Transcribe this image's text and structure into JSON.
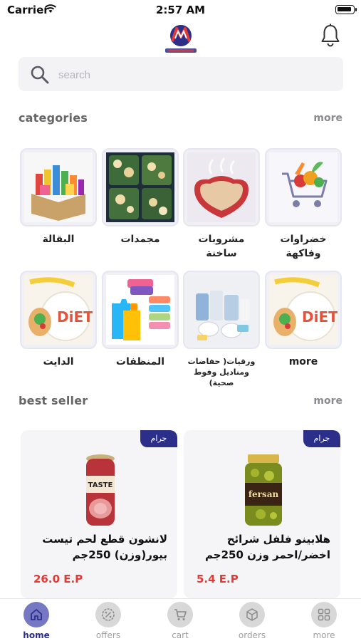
{
  "status_bar": {
    "carrier": "Carrier",
    "time": "2:57 AM"
  },
  "header": {
    "logo_icon": "store-logo-icon",
    "notification_icon": "bell-icon"
  },
  "search": {
    "placeholder": "search",
    "value": ""
  },
  "categories_section": {
    "title": "categories",
    "more_label": "more",
    "items": [
      {
        "label": "خضراوات وفاكهة",
        "icon": "vegetables-cart-image"
      },
      {
        "label": "مشروبات ساخنة",
        "icon": "hot-drinks-image"
      },
      {
        "label": "مجمدات",
        "icon": "frozen-food-image"
      },
      {
        "label": "البقالة",
        "icon": "grocery-box-image"
      },
      {
        "label": "more",
        "icon": "diet-plate-image"
      },
      {
        "label": "ورقيات( حفاضات ومناديل وفوط صحية)",
        "icon": "paper-products-image"
      },
      {
        "label": "المنظفات",
        "icon": "detergents-image"
      },
      {
        "label": "الدايت",
        "icon": "diet-plate-image"
      }
    ]
  },
  "best_seller_section": {
    "title": "best seller",
    "more_label": "more",
    "products": [
      {
        "badge": "جرام",
        "name": "هلابينو فلفل شرائح اخضر/احمر وزن 250جم",
        "price": "5.4 E.P",
        "image": "pickled-jar-image"
      },
      {
        "badge": "جرام",
        "name": "لانشون قطع لحم تيست بيور(وزن) 250جم",
        "price": "26.0 E.P",
        "image": "luncheon-meat-image"
      }
    ]
  },
  "tab_bar": {
    "items": [
      {
        "label": "home",
        "icon": "home-icon",
        "active": true
      },
      {
        "label": "offers",
        "icon": "offers-percent-icon",
        "active": false
      },
      {
        "label": "cart",
        "icon": "cart-icon",
        "active": false
      },
      {
        "label": "orders",
        "icon": "box-icon",
        "active": false
      },
      {
        "label": "more",
        "icon": "grid-icon",
        "active": false
      }
    ]
  },
  "colors": {
    "brand": "#2b2f8a",
    "price": "#e53935",
    "active_tab": "#7678c4"
  }
}
